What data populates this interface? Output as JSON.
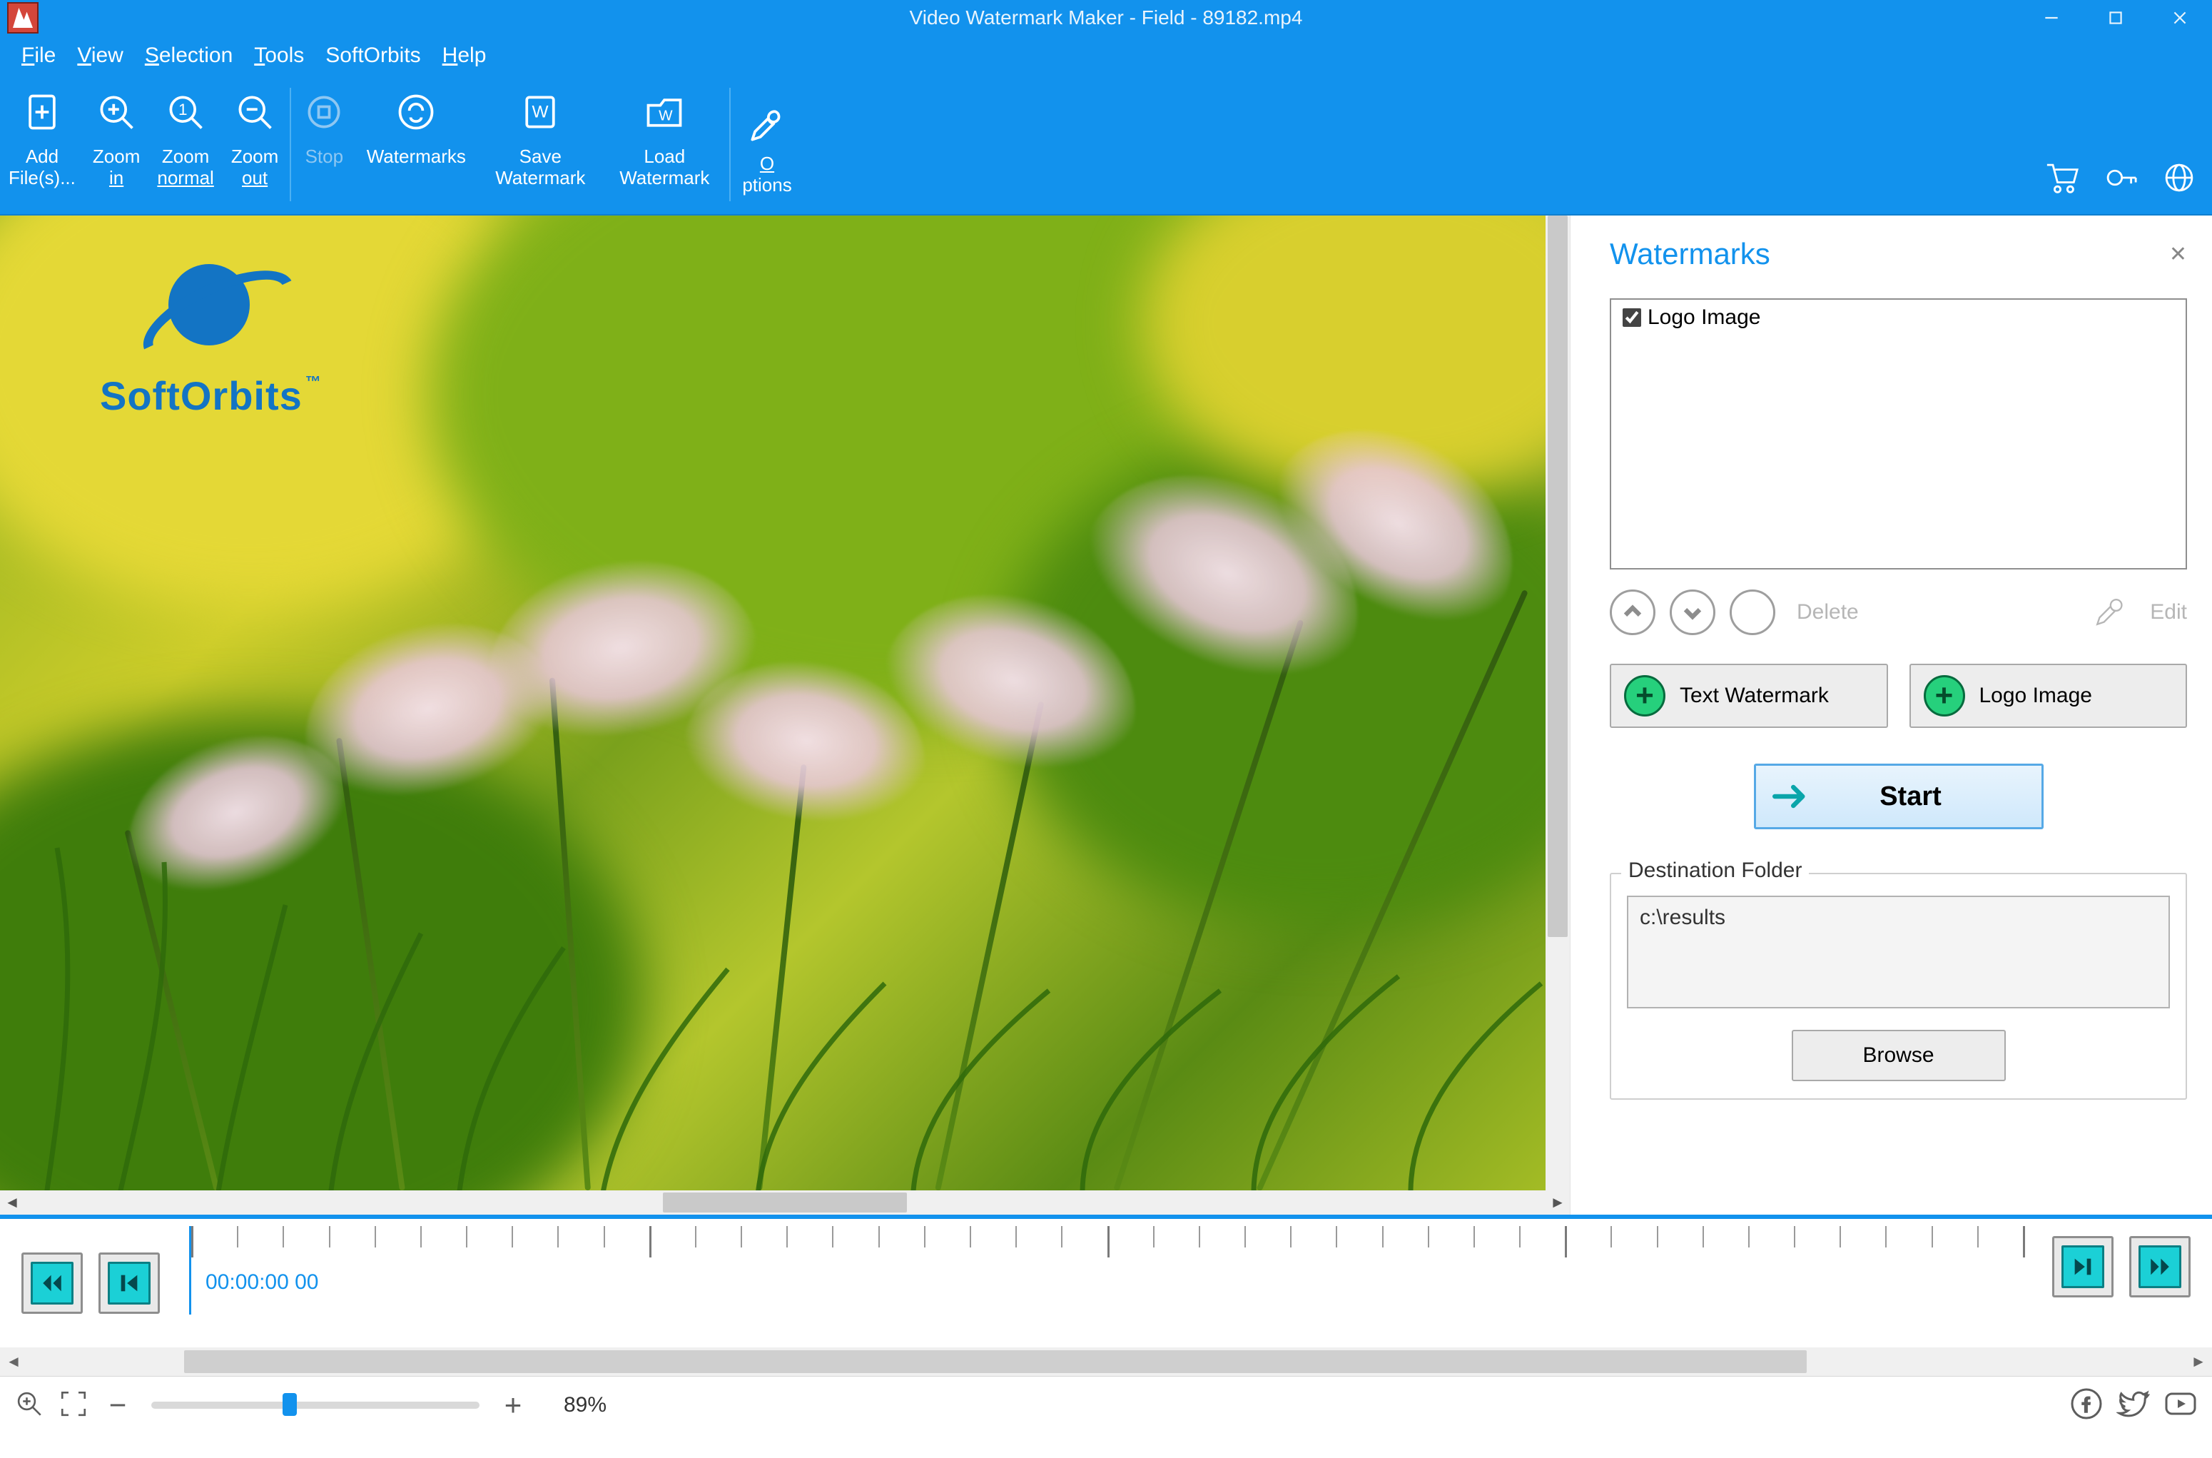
{
  "titlebar": {
    "title": "Video Watermark Maker - Field - 89182.mp4"
  },
  "menu": {
    "file": "File",
    "view": "View",
    "selection": "Selection",
    "tools": "Tools",
    "softorbits": "SoftOrbits",
    "help": "Help"
  },
  "toolbar": {
    "add_files": "Add",
    "add_files2": "File(s)...",
    "zoom_in": "Zoom",
    "zoom_in2": "in",
    "zoom_normal": "Zoom",
    "zoom_normal2": "normal",
    "zoom_out": "Zoom",
    "zoom_out2": "out",
    "stop": "Stop",
    "watermarks": "Watermarks",
    "save_wm": "Save",
    "save_wm2": "Watermark",
    "load_wm": "Load",
    "load_wm2": "Watermark",
    "options": "Options"
  },
  "watermark_logo": {
    "brand": "SoftOrbits",
    "tm": "™"
  },
  "panel": {
    "title": "Watermarks",
    "list_item": "Logo Image",
    "delete": "Delete",
    "edit": "Edit",
    "text_wm": "Text Watermark",
    "logo_img": "Logo Image",
    "start": "Start",
    "dest_legend": "Destination Folder",
    "dest_path": "c:\\results",
    "browse": "Browse"
  },
  "timeline": {
    "timecode": "00:00:00 00"
  },
  "status": {
    "zoom_pct": "89%"
  }
}
